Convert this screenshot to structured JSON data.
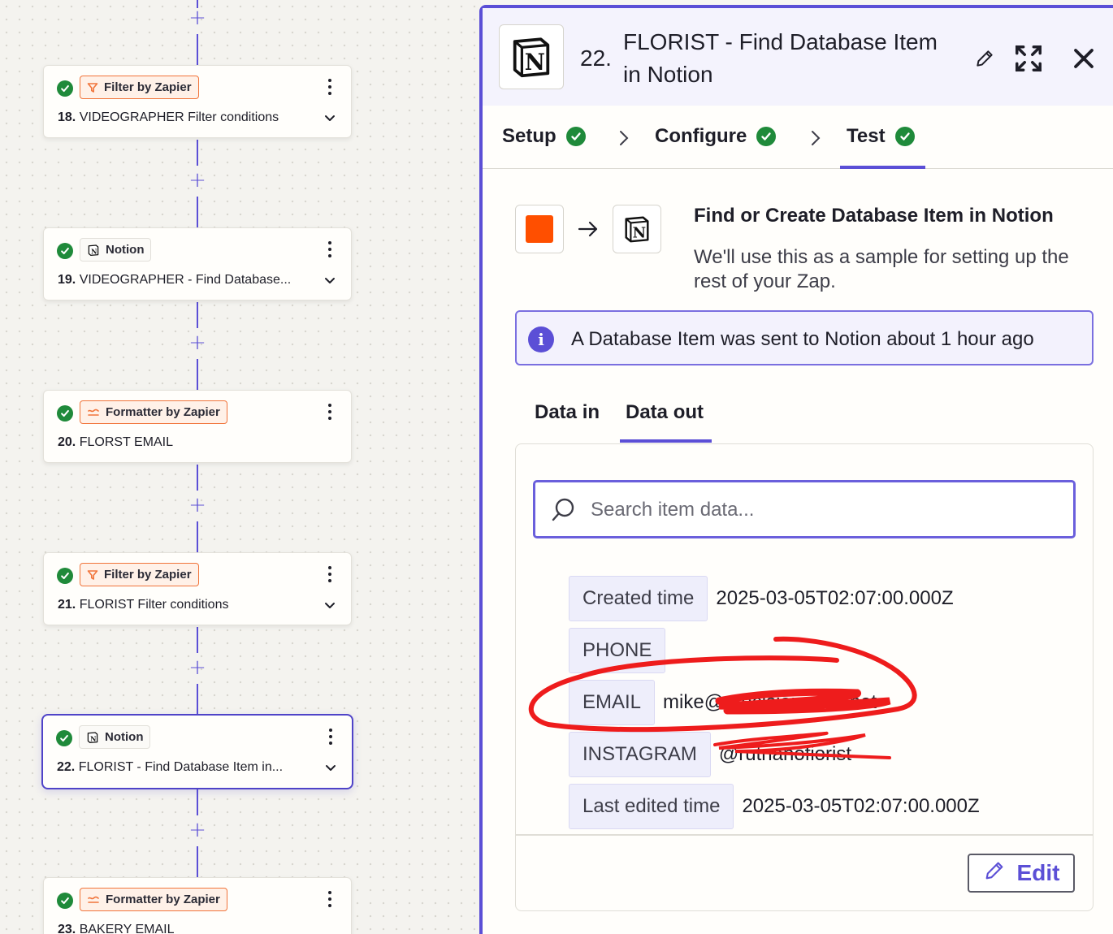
{
  "canvas": {
    "steps": [
      {
        "app": "Filter by Zapier",
        "app_kind": "filter",
        "number": "18.",
        "title": "VIDEOGRAPHER Filter conditions",
        "has_chevron": true
      },
      {
        "app": "Notion",
        "app_kind": "notion",
        "number": "19.",
        "title": "VIDEOGRAPHER - Find Database...",
        "has_chevron": true
      },
      {
        "app": "Formatter by Zapier",
        "app_kind": "formatter",
        "number": "20.",
        "title": "FLORST EMAIL",
        "has_chevron": false
      },
      {
        "app": "Filter by Zapier",
        "app_kind": "filter",
        "number": "21.",
        "title": "FLORIST Filter conditions",
        "has_chevron": true
      },
      {
        "app": "Notion",
        "app_kind": "notion",
        "number": "22.",
        "title": "FLORIST - Find Database Item in...",
        "has_chevron": true,
        "selected": true
      },
      {
        "app": "Formatter by Zapier",
        "app_kind": "formatter",
        "number": "23.",
        "title": "BAKERY EMAIL",
        "has_chevron": false
      }
    ],
    "add_step_symbol": "+"
  },
  "panel": {
    "step_number": "22.",
    "title": "FLORIST - Find Database Item in Notion",
    "tabs": [
      {
        "label": "Setup",
        "complete": true
      },
      {
        "label": "Configure",
        "complete": true
      },
      {
        "label": "Test",
        "complete": true,
        "active": true
      }
    ],
    "action_title": "Find or Create Database Item in Notion",
    "action_desc": "We'll use this as a sample for setting up the rest of your Zap.",
    "info_banner": "A Database Item was sent to Notion about 1 hour ago",
    "data_tabs": [
      {
        "label": "Data in",
        "active": false
      },
      {
        "label": "Data out",
        "active": true
      }
    ],
    "search_placeholder": "Search item data...",
    "fields": [
      {
        "key": "Created time",
        "value": "2025-03-05T02:07:00.000Z"
      },
      {
        "key": "PHONE",
        "value": ""
      },
      {
        "key": "EMAIL",
        "value": "mike@precisionmind.net"
      },
      {
        "key": "INSTAGRAM",
        "value": "@rutnanofiorist"
      },
      {
        "key": "Last edited time",
        "value": "2025-03-05T02:07:00.000Z"
      }
    ],
    "edit_label": "Edit"
  },
  "colors": {
    "accent": "#5b4fd6",
    "success": "#1f8a3a",
    "zapier_orange": "#ff4f00",
    "annotation_red": "#ee1c1c"
  }
}
